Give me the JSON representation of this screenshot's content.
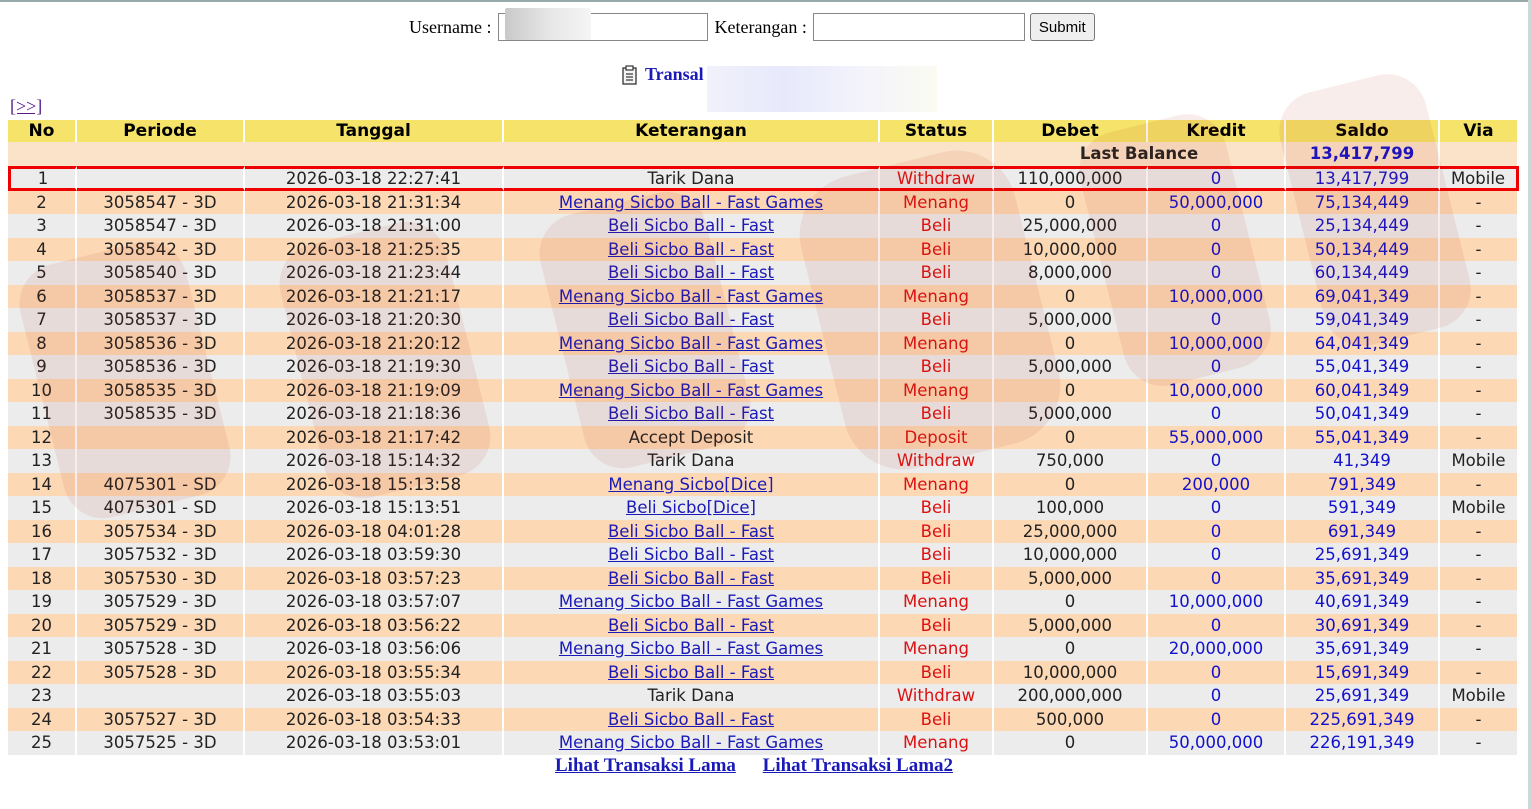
{
  "form": {
    "username_label": "Username :",
    "username_value": "",
    "keterangan_label": "Keterangan :",
    "keterangan_value": "",
    "submit_label": "Submit"
  },
  "title": "Transal",
  "next_link": "[>>]",
  "columns": [
    "No",
    "Periode",
    "Tanggal",
    "Keterangan",
    "Status",
    "Debet",
    "Kredit",
    "Saldo",
    "Via"
  ],
  "last_balance": {
    "label": "Last Balance",
    "value": "13,417,799"
  },
  "rows": [
    {
      "no": "1",
      "periode": "",
      "tanggal": "2026-03-18 22:27:41",
      "ket": "Tarik Dana",
      "link": false,
      "status": "Withdraw",
      "debet": "110,000,000",
      "kredit": "0",
      "saldo": "13,417,799",
      "via": "Mobile"
    },
    {
      "no": "2",
      "periode": "3058547 - 3D",
      "tanggal": "2026-03-18 21:31:34",
      "ket": "Menang Sicbo Ball - Fast Games",
      "link": true,
      "status": "Menang",
      "debet": "0",
      "kredit": "50,000,000",
      "saldo": "75,134,449",
      "via": "-"
    },
    {
      "no": "3",
      "periode": "3058547 - 3D",
      "tanggal": "2026-03-18 21:31:00",
      "ket": "Beli Sicbo Ball - Fast",
      "link": true,
      "status": "Beli",
      "debet": "25,000,000",
      "kredit": "0",
      "saldo": "25,134,449",
      "via": "-"
    },
    {
      "no": "4",
      "periode": "3058542 - 3D",
      "tanggal": "2026-03-18 21:25:35",
      "ket": "Beli Sicbo Ball - Fast",
      "link": true,
      "status": "Beli",
      "debet": "10,000,000",
      "kredit": "0",
      "saldo": "50,134,449",
      "via": "-"
    },
    {
      "no": "5",
      "periode": "3058540 - 3D",
      "tanggal": "2026-03-18 21:23:44",
      "ket": "Beli Sicbo Ball - Fast",
      "link": true,
      "status": "Beli",
      "debet": "8,000,000",
      "kredit": "0",
      "saldo": "60,134,449",
      "via": "-"
    },
    {
      "no": "6",
      "periode": "3058537 - 3D",
      "tanggal": "2026-03-18 21:21:17",
      "ket": "Menang Sicbo Ball - Fast Games",
      "link": true,
      "status": "Menang",
      "debet": "0",
      "kredit": "10,000,000",
      "saldo": "69,041,349",
      "via": "-"
    },
    {
      "no": "7",
      "periode": "3058537 - 3D",
      "tanggal": "2026-03-18 21:20:30",
      "ket": "Beli Sicbo Ball - Fast",
      "link": true,
      "status": "Beli",
      "debet": "5,000,000",
      "kredit": "0",
      "saldo": "59,041,349",
      "via": "-"
    },
    {
      "no": "8",
      "periode": "3058536 - 3D",
      "tanggal": "2026-03-18 21:20:12",
      "ket": "Menang Sicbo Ball - Fast Games",
      "link": true,
      "status": "Menang",
      "debet": "0",
      "kredit": "10,000,000",
      "saldo": "64,041,349",
      "via": "-"
    },
    {
      "no": "9",
      "periode": "3058536 - 3D",
      "tanggal": "2026-03-18 21:19:30",
      "ket": "Beli Sicbo Ball - Fast",
      "link": true,
      "status": "Beli",
      "debet": "5,000,000",
      "kredit": "0",
      "saldo": "55,041,349",
      "via": "-"
    },
    {
      "no": "10",
      "periode": "3058535 - 3D",
      "tanggal": "2026-03-18 21:19:09",
      "ket": "Menang Sicbo Ball - Fast Games",
      "link": true,
      "status": "Menang",
      "debet": "0",
      "kredit": "10,000,000",
      "saldo": "60,041,349",
      "via": "-"
    },
    {
      "no": "11",
      "periode": "3058535 - 3D",
      "tanggal": "2026-03-18 21:18:36",
      "ket": "Beli Sicbo Ball - Fast",
      "link": true,
      "status": "Beli",
      "debet": "5,000,000",
      "kredit": "0",
      "saldo": "50,041,349",
      "via": "-"
    },
    {
      "no": "12",
      "periode": "",
      "tanggal": "2026-03-18 21:17:42",
      "ket": "Accept Deposit",
      "link": false,
      "status": "Deposit",
      "debet": "0",
      "kredit": "55,000,000",
      "saldo": "55,041,349",
      "via": "-"
    },
    {
      "no": "13",
      "periode": "",
      "tanggal": "2026-03-18 15:14:32",
      "ket": "Tarik Dana",
      "link": false,
      "status": "Withdraw",
      "debet": "750,000",
      "kredit": "0",
      "saldo": "41,349",
      "via": "Mobile"
    },
    {
      "no": "14",
      "periode": "4075301 - SD",
      "tanggal": "2026-03-18 15:13:58",
      "ket": "Menang Sicbo[Dice]",
      "link": true,
      "status": "Menang",
      "debet": "0",
      "kredit": "200,000",
      "saldo": "791,349",
      "via": "-"
    },
    {
      "no": "15",
      "periode": "4075301 - SD",
      "tanggal": "2026-03-18 15:13:51",
      "ket": "Beli Sicbo[Dice]",
      "link": true,
      "status": "Beli",
      "debet": "100,000",
      "kredit": "0",
      "saldo": "591,349",
      "via": "Mobile"
    },
    {
      "no": "16",
      "periode": "3057534 - 3D",
      "tanggal": "2026-03-18 04:01:28",
      "ket": "Beli Sicbo Ball - Fast",
      "link": true,
      "status": "Beli",
      "debet": "25,000,000",
      "kredit": "0",
      "saldo": "691,349",
      "via": "-"
    },
    {
      "no": "17",
      "periode": "3057532 - 3D",
      "tanggal": "2026-03-18 03:59:30",
      "ket": "Beli Sicbo Ball - Fast",
      "link": true,
      "status": "Beli",
      "debet": "10,000,000",
      "kredit": "0",
      "saldo": "25,691,349",
      "via": "-"
    },
    {
      "no": "18",
      "periode": "3057530 - 3D",
      "tanggal": "2026-03-18 03:57:23",
      "ket": "Beli Sicbo Ball - Fast",
      "link": true,
      "status": "Beli",
      "debet": "5,000,000",
      "kredit": "0",
      "saldo": "35,691,349",
      "via": "-"
    },
    {
      "no": "19",
      "periode": "3057529 - 3D",
      "tanggal": "2026-03-18 03:57:07",
      "ket": "Menang Sicbo Ball - Fast Games",
      "link": true,
      "status": "Menang",
      "debet": "0",
      "kredit": "10,000,000",
      "saldo": "40,691,349",
      "via": "-"
    },
    {
      "no": "20",
      "periode": "3057529 - 3D",
      "tanggal": "2026-03-18 03:56:22",
      "ket": "Beli Sicbo Ball - Fast",
      "link": true,
      "status": "Beli",
      "debet": "5,000,000",
      "kredit": "0",
      "saldo": "30,691,349",
      "via": "-"
    },
    {
      "no": "21",
      "periode": "3057528 - 3D",
      "tanggal": "2026-03-18 03:56:06",
      "ket": "Menang Sicbo Ball - Fast Games",
      "link": true,
      "status": "Menang",
      "debet": "0",
      "kredit": "20,000,000",
      "saldo": "35,691,349",
      "via": "-"
    },
    {
      "no": "22",
      "periode": "3057528 - 3D",
      "tanggal": "2026-03-18 03:55:34",
      "ket": "Beli Sicbo Ball - Fast",
      "link": true,
      "status": "Beli",
      "debet": "10,000,000",
      "kredit": "0",
      "saldo": "15,691,349",
      "via": "-"
    },
    {
      "no": "23",
      "periode": "",
      "tanggal": "2026-03-18 03:55:03",
      "ket": "Tarik Dana",
      "link": false,
      "status": "Withdraw",
      "debet": "200,000,000",
      "kredit": "0",
      "saldo": "25,691,349",
      "via": "Mobile"
    },
    {
      "no": "24",
      "periode": "3057527 - 3D",
      "tanggal": "2026-03-18 03:54:33",
      "ket": "Beli Sicbo Ball - Fast",
      "link": true,
      "status": "Beli",
      "debet": "500,000",
      "kredit": "0",
      "saldo": "225,691,349",
      "via": "-"
    },
    {
      "no": "25",
      "periode": "3057525 - 3D",
      "tanggal": "2026-03-18 03:53:01",
      "ket": "Menang Sicbo Ball - Fast Games",
      "link": true,
      "status": "Menang",
      "debet": "0",
      "kredit": "50,000,000",
      "saldo": "226,191,349",
      "via": "-"
    }
  ],
  "footer_links": [
    "Lihat Transaksi Lama",
    "Lihat Transaksi Lama2"
  ],
  "colors": {
    "header_bg": "#f5e36a",
    "row_alt_a": "#ececec",
    "row_alt_b": "#fcd8b5",
    "status_red": "#dd1111",
    "link_blue": "#1a1ab8",
    "highlight_border": "#e00000"
  },
  "icons": [
    "clipboard-icon"
  ]
}
